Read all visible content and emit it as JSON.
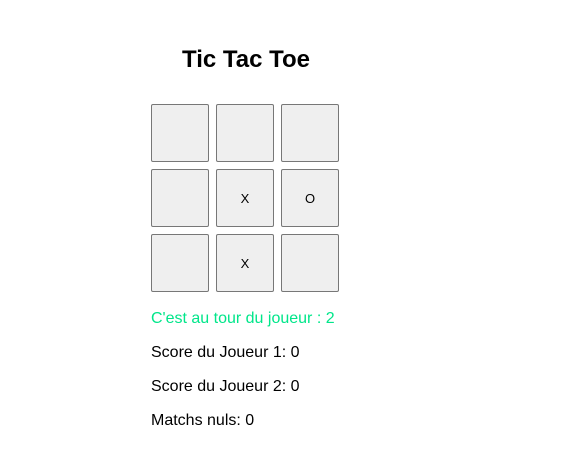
{
  "game": {
    "title": "Tic Tac Toe",
    "board": [
      [
        "",
        "",
        ""
      ],
      [
        "",
        "X",
        "O"
      ],
      [
        "",
        "X",
        ""
      ]
    ],
    "status": "C'est au tour du joueur : 2",
    "status_color": "#00e68a",
    "scores": [
      "Score du Joueur 1: 0",
      "Score du Joueur 2: 0",
      "Matchs nuls: 0"
    ]
  }
}
